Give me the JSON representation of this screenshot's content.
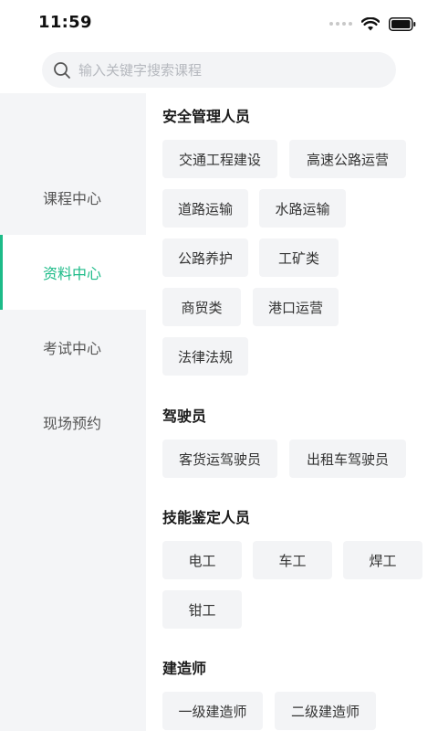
{
  "status_bar": {
    "time": "11:59",
    "icons": [
      "signal-dots-icon",
      "wifi-icon",
      "battery-icon"
    ]
  },
  "search": {
    "placeholder": "输入关键字搜索课程",
    "icon": "search-icon"
  },
  "colors": {
    "accent": "#1dbb88",
    "sidebar_bg": "#f4f5f7",
    "chip_bg": "#f3f4f6"
  },
  "sidebar": {
    "items": [
      {
        "label": "课程中心",
        "active": false
      },
      {
        "label": "资料中心",
        "active": true
      },
      {
        "label": "考试中心",
        "active": false
      },
      {
        "label": "现场预约",
        "active": false
      }
    ]
  },
  "sections": [
    {
      "title": "安全管理人员",
      "chips": [
        "交通工程建设",
        "高速公路运营",
        "道路运输",
        "水路运输",
        "公路养护",
        "工矿类",
        "商贸类",
        "港口运营",
        "法律法规"
      ]
    },
    {
      "title": "驾驶员",
      "chips": [
        "客货运驾驶员",
        "出租车驾驶员"
      ]
    },
    {
      "title": "技能鉴定人员",
      "chips": [
        "电工",
        "车工",
        "焊工",
        "钳工"
      ]
    },
    {
      "title": "建造师",
      "chips": [
        "一级建造师",
        "二级建造师"
      ]
    }
  ]
}
